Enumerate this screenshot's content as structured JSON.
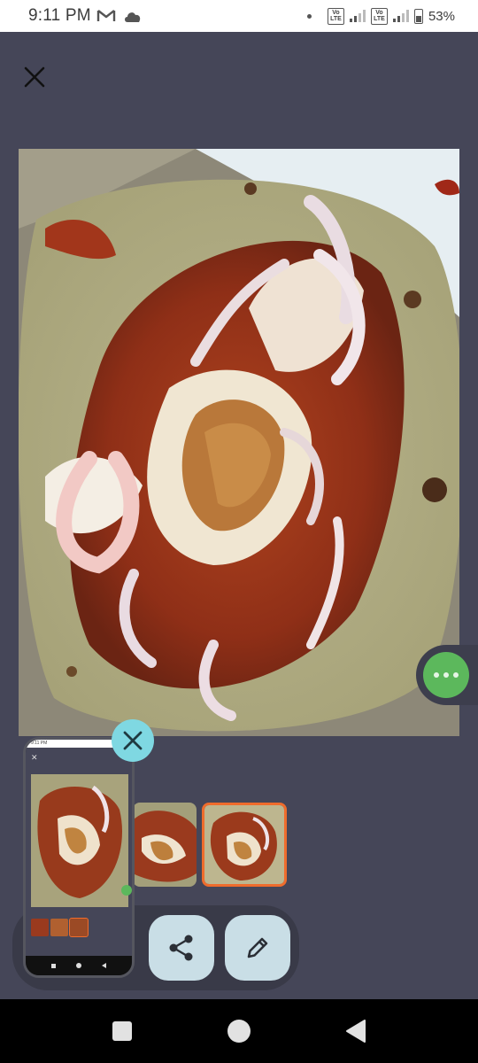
{
  "status_bar": {
    "time": "9:11 PM",
    "notification_icons": [
      "gmail-icon",
      "cloud-icon"
    ],
    "volte_label_1": "Vo\nLTE",
    "volte_label_2": "Vo\nLTE",
    "battery": "53%",
    "icons": [
      "volte-icon",
      "signal-icon",
      "volte-icon",
      "signal-icon",
      "battery-icon"
    ]
  },
  "viewer": {
    "close_icon": "close-icon",
    "photo_subject": "tortilla-with-chorizo-eggs-onions"
  },
  "bubble": {
    "icon": "more-dots-icon",
    "color": "#5cb85c"
  },
  "thumbnails": {
    "count": 3,
    "selected_index": 2,
    "accent": "#ef6c2c"
  },
  "actions": {
    "share_icon": "share-icon",
    "edit_icon": "pencil-icon",
    "button_color": "#c9dee6"
  },
  "preview": {
    "status_time": "9:11 PM",
    "close_icon": "close-icon",
    "dismiss_color": "#7fd8e2"
  },
  "nav": {
    "recents_icon": "square-icon",
    "home_icon": "circle-icon",
    "back_icon": "triangle-back-icon"
  },
  "colors": {
    "background": "#454658",
    "panel": "#393a48"
  }
}
